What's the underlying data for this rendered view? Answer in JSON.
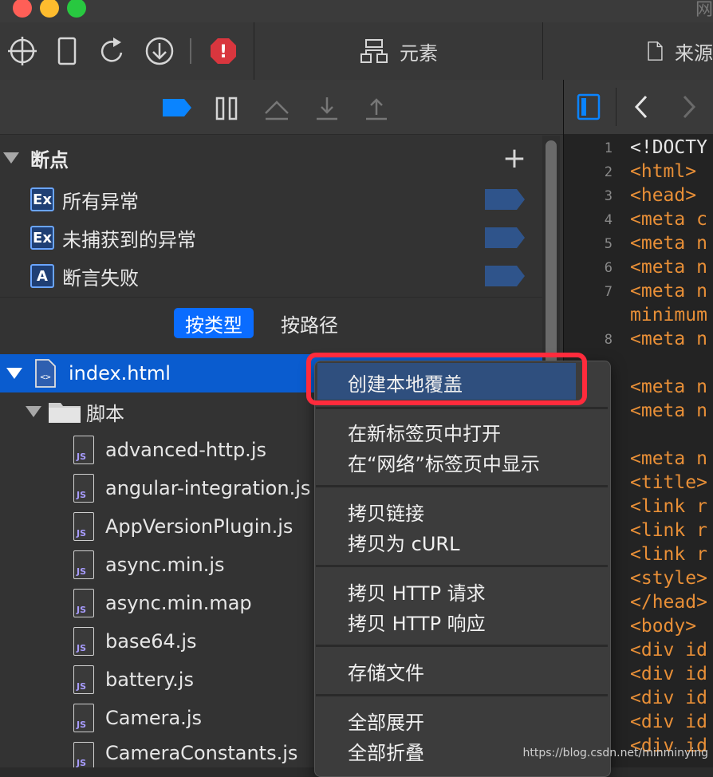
{
  "window": {
    "title_fragment": "网"
  },
  "toolbar": {
    "icons": [
      "crosshair-icon",
      "device-icon",
      "reload-icon",
      "download-icon",
      "stop-icon"
    ],
    "tabs": [
      {
        "label": "元素",
        "icon": "elements-icon"
      },
      {
        "label": "来源",
        "icon": "document-icon"
      }
    ]
  },
  "breakpoints": {
    "title": "断点",
    "add_label": "+",
    "items": [
      {
        "badge": "Ex",
        "label": "所有异常"
      },
      {
        "badge": "Ex",
        "label": "未捕获到的异常"
      },
      {
        "badge": "A",
        "label": "断言失败"
      }
    ]
  },
  "scope": {
    "by_type": "按类型",
    "by_path": "按路径"
  },
  "tree": {
    "root": "index.html",
    "folder": "脚本",
    "files": [
      "advanced-http.js",
      "angular-integration.js",
      "AppVersionPlugin.js",
      "async.min.js",
      "async.min.map",
      "base64.js",
      "battery.js",
      "Camera.js",
      "CameraConstants.js"
    ]
  },
  "code": {
    "line_numbers": [
      "1",
      "2",
      "3",
      "4",
      "5",
      "6",
      "7",
      "",
      "8",
      "",
      "",
      "",
      "",
      "",
      "",
      "",
      "",
      "",
      "",
      "",
      "",
      "",
      ""
    ],
    "lines": [
      "<!DOCTY",
      "<html>",
      "<head>",
      "<meta c",
      "<meta n",
      "<meta n",
      "<meta n",
      "minimum",
      "<meta n",
      "",
      "<meta n",
      "<meta n",
      "",
      "<meta n",
      "<title>",
      "<link r",
      "<link r",
      "<link r",
      "<style>",
      "</head>",
      "<body>",
      "<div id",
      "<div id",
      "<div id",
      "<div id",
      "<div id"
    ]
  },
  "context_menu": {
    "items": [
      "创建本地覆盖",
      "在新标签页中打开",
      "在“网络”标签页中显示",
      "拷贝链接",
      "拷贝为 cURL",
      "拷贝 HTTP 请求",
      "拷贝 HTTP 响应",
      "存储文件",
      "全部展开",
      "全部折叠"
    ]
  },
  "watermark": "https://blog.csdn.net/minminying",
  "colors": {
    "accent": "#0a6cff",
    "highlight_border": "#ff2b3c",
    "code_tag": "#e88f37"
  }
}
